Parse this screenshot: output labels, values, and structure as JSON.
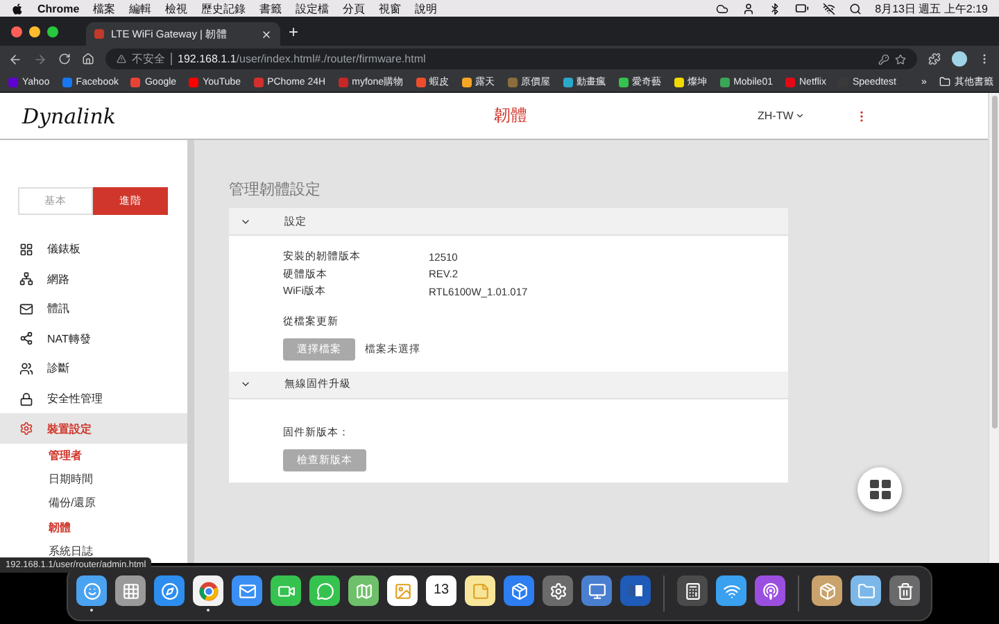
{
  "menu_bar": {
    "app": "Chrome",
    "menus": [
      "檔案",
      "編輯",
      "檢視",
      "歷史記錄",
      "書籤",
      "設定檔",
      "分頁",
      "視窗",
      "說明"
    ],
    "clock": "8月13日 週五 上午2:19"
  },
  "browser": {
    "tabs": [
      {
        "title": "LTE WiFi Gateway | 韌體",
        "selected": true
      }
    ],
    "new_tab": "+",
    "security": "不安全",
    "url_host": "192.168.1.1",
    "url_path": "/user/index.html#./router/firmware.html",
    "bookmarks": [
      {
        "label": "Yahoo",
        "color": "#6001d2"
      },
      {
        "label": "Facebook",
        "color": "#1877f2"
      },
      {
        "label": "Google",
        "color": "#ea4335"
      },
      {
        "label": "YouTube",
        "color": "#ff0000"
      },
      {
        "label": "PChome 24H",
        "color": "#d32f2f"
      },
      {
        "label": "myfone購物",
        "color": "#c62828"
      },
      {
        "label": "蝦皮",
        "color": "#ee4d2d"
      },
      {
        "label": "露天",
        "color": "#f5a623"
      },
      {
        "label": "原價屋",
        "color": "#8a6d3b"
      },
      {
        "label": "動畫瘋",
        "color": "#2aa8c9"
      },
      {
        "label": "愛奇藝",
        "color": "#36c24f"
      },
      {
        "label": "燦坤",
        "color": "#f2d900"
      },
      {
        "label": "Mobile01",
        "color": "#3aa757"
      },
      {
        "label": "Netflix",
        "color": "#e50914"
      },
      {
        "label": "Speedtest",
        "color": "#3a3a3a"
      }
    ],
    "more_bookmarks": "»",
    "other_bookmarks": "其他書籤",
    "status_url": "192.168.1.1/user/router/admin.html"
  },
  "page": {
    "logo": "Dynalink",
    "title": "韌體",
    "language": "ZH-TW",
    "mode_tabs": [
      {
        "label": "基本",
        "selected": false
      },
      {
        "label": "進階",
        "selected": true
      }
    ],
    "sidebar": [
      {
        "label": "儀錶板",
        "selected": false
      },
      {
        "label": "網路",
        "selected": false
      },
      {
        "label": "體訊",
        "selected": false
      },
      {
        "label": "NAT轉發",
        "selected": false
      },
      {
        "label": "診斷",
        "selected": false
      },
      {
        "label": "安全性管理",
        "selected": false
      },
      {
        "label": "裝置設定",
        "selected": true,
        "expanded": true,
        "children": [
          {
            "label": "管理者",
            "selected": true
          },
          {
            "label": "日期時間",
            "selected": false
          },
          {
            "label": "備份/還原",
            "selected": false
          },
          {
            "label": "韌體",
            "selected": true
          },
          {
            "label": "系統日誌",
            "selected": false
          }
        ]
      }
    ],
    "heading": "管理韌體設定",
    "sections": [
      {
        "title": "設定",
        "expanded": true,
        "rows": [
          {
            "label": "安裝的韌體版本",
            "value": "12510"
          },
          {
            "label": "硬體版本",
            "value": "REV.2"
          },
          {
            "label": "WiFi版本",
            "value": "RTL6100W_1.01.017"
          }
        ],
        "subheading": "從檔案更新",
        "button": {
          "label": "選擇檔案",
          "disabled": true
        },
        "note": "檔案未選擇"
      },
      {
        "title": "無線固件升級",
        "expanded": true,
        "subheading": "固件新版本：",
        "button": {
          "label": "檢查新版本",
          "disabled": true
        }
      }
    ]
  },
  "dock": [
    {
      "kind": "app",
      "running": true
    },
    {
      "kind": "app",
      "running": false
    },
    {
      "kind": "app",
      "running": false
    },
    {
      "kind": "app",
      "running": true
    },
    {
      "kind": "app",
      "running": false
    },
    {
      "kind": "app",
      "running": false
    },
    {
      "kind": "app",
      "running": false
    },
    {
      "kind": "app",
      "running": false
    },
    {
      "kind": "app",
      "running": false
    },
    {
      "kind": "app",
      "running": false,
      "text": "13"
    },
    {
      "kind": "app",
      "running": false
    },
    {
      "kind": "app",
      "running": false
    },
    {
      "kind": "app",
      "running": false
    },
    {
      "kind": "app",
      "running": false
    },
    {
      "kind": "app",
      "running": false
    },
    {
      "kind": "separator"
    },
    {
      "kind": "app",
      "running": false
    },
    {
      "kind": "app",
      "running": false
    },
    {
      "kind": "app",
      "running": false
    },
    {
      "kind": "separator"
    },
    {
      "kind": "app",
      "running": false
    },
    {
      "kind": "app",
      "running": false
    },
    {
      "kind": "app",
      "running": false
    }
  ]
}
